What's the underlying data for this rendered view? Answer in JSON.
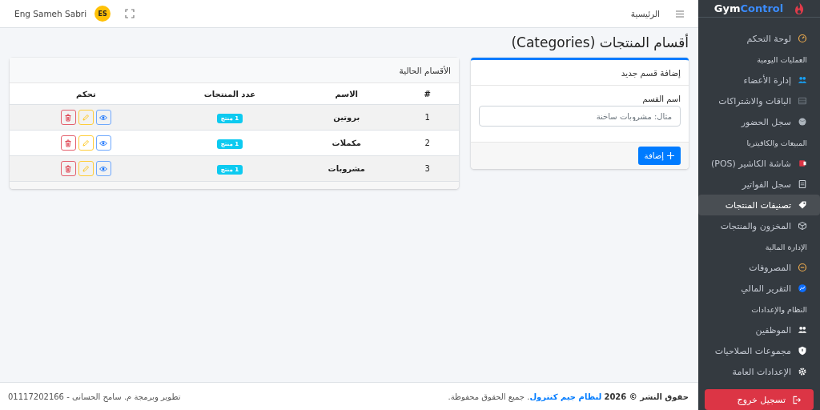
{
  "sidebar": {
    "brand": {
      "part_1": "Gym",
      "part_2": "Control"
    },
    "items": [
      {
        "kind": "link",
        "label": "لوحة التحكم",
        "selected": false
      },
      {
        "kind": "header",
        "label": "العمليات اليومية"
      },
      {
        "kind": "link",
        "label": "إدارة الأعضاء",
        "selected": false
      },
      {
        "kind": "link",
        "label": "الباقات والاشتراكات",
        "selected": false
      },
      {
        "kind": "link",
        "label": "سجل الحضور",
        "selected": false
      },
      {
        "kind": "header",
        "label": "المبيعات والكافيتريا"
      },
      {
        "kind": "link",
        "label": "شاشة الكاشير (POS)",
        "selected": false
      },
      {
        "kind": "link",
        "label": "سجل الفواتير",
        "selected": false
      },
      {
        "kind": "link",
        "label": "تصنيفات المنتجات",
        "selected": true
      },
      {
        "kind": "link",
        "label": "المخزون والمنتجات",
        "selected": false
      },
      {
        "kind": "header",
        "label": "الإدارة المالية"
      },
      {
        "kind": "link",
        "label": "المصروفات",
        "selected": false
      },
      {
        "kind": "link",
        "label": "التقرير المالي",
        "selected": false
      },
      {
        "kind": "header",
        "label": "النظام والإعدادات"
      },
      {
        "kind": "link",
        "label": "الموظفين",
        "selected": false
      },
      {
        "kind": "link",
        "label": "مجموعات الصلاحيات",
        "selected": false
      },
      {
        "kind": "link",
        "label": "الإعدادات العامة",
        "selected": false
      }
    ],
    "logout": "تسجيل خروج"
  },
  "topbar": {
    "home": "الرئيسية",
    "user": "Eng Sameh Sabri",
    "avatar": "ES"
  },
  "page_title": "أقسام المنتجات (Categories)",
  "form_card": {
    "title": "إضافة قسم جديد",
    "field_label": "اسم القسم",
    "placeholder": "مثال: مشروبات ساخنة",
    "submit": "إضافة"
  },
  "table_card": {
    "title": "الأقسام الحالية",
    "columns": [
      "#",
      "الاسم",
      "عدد المنتجات",
      "تحكم"
    ],
    "rows": [
      {
        "index": "1",
        "name": "بروتين",
        "count": "1 منتج"
      },
      {
        "index": "2",
        "name": "مكملات",
        "count": "1 منتج"
      },
      {
        "index": "3",
        "name": "مشروبات",
        "count": "1 منتج"
      }
    ]
  },
  "footer": {
    "copyright_prefix": "حقوق النشر © 2026",
    "copyright_link": "لنظام جيم كنترول",
    "copyright_suffix": ". جميع الحقوق محفوظة.",
    "credit": "تطوير وبرمجة م. سامح الحسانى - 01117202166"
  }
}
